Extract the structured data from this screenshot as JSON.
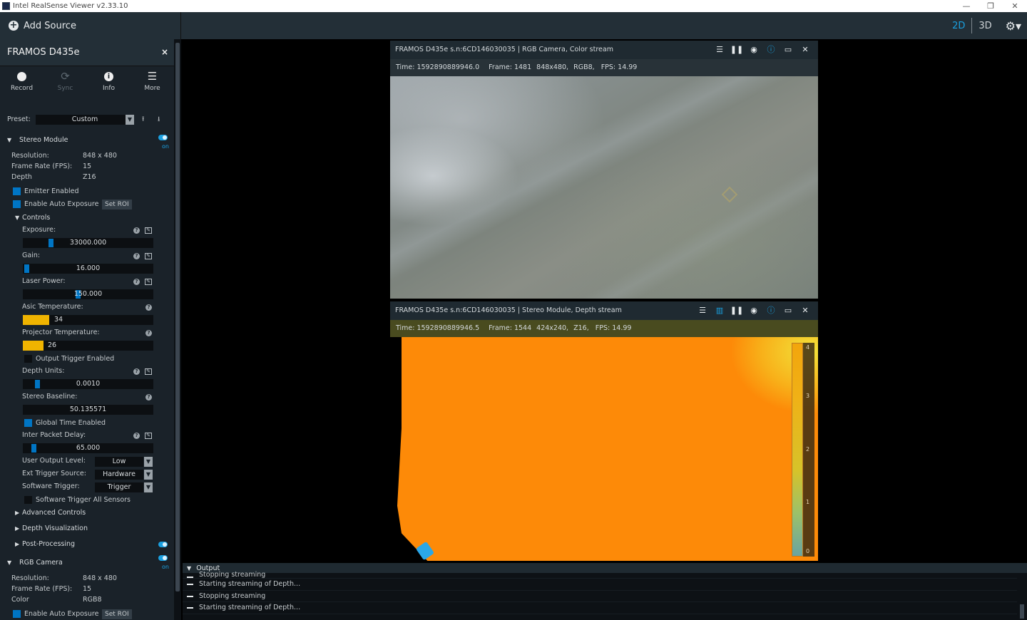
{
  "window": {
    "title": "Intel RealSense Viewer v2.33.10",
    "controls": [
      "—",
      "❐",
      "✕"
    ]
  },
  "topbar": {
    "add_source": "Add Source",
    "mode_2d": "2D",
    "mode_3d": "3D"
  },
  "device": {
    "name": "FRAMOS D435e",
    "close": "×",
    "tools": [
      {
        "label": "Record",
        "icon": "record-icon"
      },
      {
        "label": "Sync",
        "icon": "sync-icon"
      },
      {
        "label": "Info",
        "icon": "info-icon"
      },
      {
        "label": "More",
        "icon": "menu-icon"
      }
    ],
    "preset_label": "Preset:",
    "preset_value": "Custom"
  },
  "stereo": {
    "title": "Stereo Module",
    "on": "on",
    "resolution_label": "Resolution:",
    "resolution": "848 x 480",
    "fps_label": "Frame Rate (FPS):",
    "fps": "15",
    "format_label": "Depth",
    "format": "Z16",
    "emitter": "Emitter Enabled",
    "auto_exposure": "Enable Auto Exposure",
    "set_roi": "Set ROI",
    "controls_title": "Controls",
    "exposure_label": "Exposure:",
    "exposure": "33000.000",
    "gain_label": "Gain:",
    "gain": "16.000",
    "laser_label": "Laser Power:",
    "laser": "150.000",
    "asic_label": "Asic Temperature:",
    "asic": "34",
    "proj_label": "Projector Temperature:",
    "proj": "26",
    "output_trigger": "Output Trigger Enabled",
    "depth_units_label": "Depth Units:",
    "depth_units": "0.0010",
    "baseline_label": "Stereo Baseline:",
    "baseline": "50.135571",
    "global_time": "Global Time Enabled",
    "packet_delay_label": "Inter Packet Delay:",
    "packet_delay": "65.000",
    "user_output_label": "User Output Level:",
    "user_output": "Low",
    "ext_trigger_label": "Ext Trigger Source:",
    "ext_trigger": "Hardware",
    "sw_trigger_label": "Software Trigger:",
    "sw_trigger": "Trigger",
    "sw_trigger_all": "Software Trigger All Sensors",
    "advanced": "Advanced Controls",
    "depth_vis": "Depth Visualization",
    "post": "Post-Processing"
  },
  "rgb": {
    "title": "RGB Camera",
    "on": "on",
    "resolution_label": "Resolution:",
    "resolution": "848 x 480",
    "fps_label": "Frame Rate (FPS):",
    "fps": "15",
    "format_label": "Color",
    "format": "RGB8",
    "auto_exposure": "Enable Auto Exposure",
    "set_roi": "Set ROI"
  },
  "color_stream": {
    "title": "FRAMOS D435e s.n:6CD146030035 | RGB Camera, Color stream",
    "time": "Time: 1592890889946.0",
    "frame": "Frame: 1481",
    "res": "848x480,",
    "fmt": "RGB8,",
    "fps": "FPS:   14.99"
  },
  "depth_stream": {
    "title": "FRAMOS D435e s.n:6CD146030035 | Stereo Module, Depth stream",
    "time": "Time: 1592890889946.5",
    "frame": "Frame: 1544",
    "res": "424x240,",
    "fmt": "Z16,",
    "fps": "FPS:   14.99",
    "scale": [
      "4",
      "3",
      "2",
      "1",
      "0"
    ]
  },
  "output": {
    "title": "Output",
    "lines": [
      "Stopping streaming",
      "Starting streaming of Depth...",
      "Stopping streaming",
      "Starting streaming of Depth..."
    ]
  },
  "colors": {
    "accent": "#1aa0e0",
    "panel": "#1a2229",
    "header": "#232f37",
    "depth": "#fd8a08"
  }
}
